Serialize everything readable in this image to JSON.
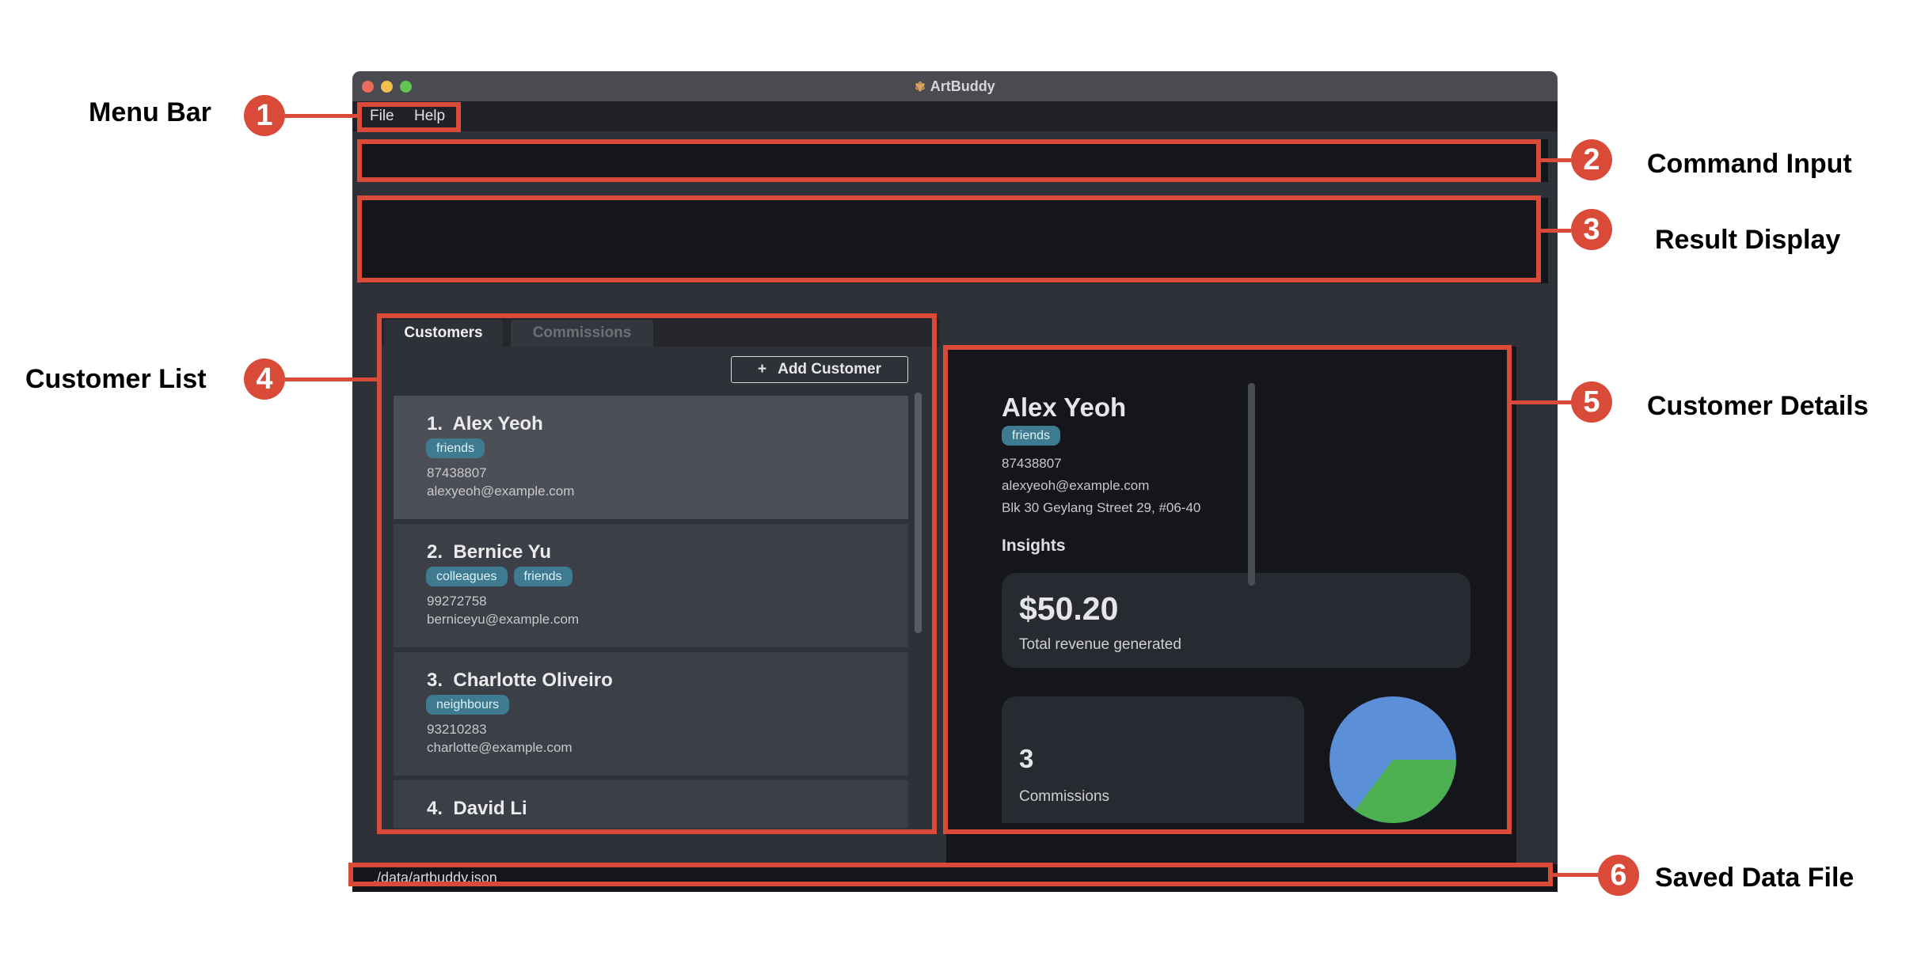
{
  "window": {
    "title": "ArtBuddy"
  },
  "menu": {
    "file": "File",
    "help": "Help"
  },
  "tabs": [
    {
      "label": "Customers"
    },
    {
      "label": "Commissions"
    }
  ],
  "add_customer": {
    "plus": "+",
    "label": "Add Customer"
  },
  "customers": [
    {
      "index": "1.",
      "name": "Alex Yeoh",
      "tags": [
        "friends"
      ],
      "phone": "87438807",
      "email": "alexyeoh@example.com"
    },
    {
      "index": "2.",
      "name": "Bernice Yu",
      "tags": [
        "colleagues",
        "friends"
      ],
      "phone": "99272758",
      "email": "berniceyu@example.com"
    },
    {
      "index": "3.",
      "name": "Charlotte Oliveiro",
      "tags": [
        "neighbours"
      ],
      "phone": "93210283",
      "email": "charlotte@example.com"
    },
    {
      "index": "4.",
      "name": "David Li",
      "tags": [],
      "phone": "",
      "email": ""
    }
  ],
  "details": {
    "name": "Alex Yeoh",
    "tag": "friends",
    "phone": "87438807",
    "email": "alexyeoh@example.com",
    "address": "Blk 30 Geylang Street 29, #06-40",
    "insights_heading": "Insights",
    "revenue_value": "$50.20",
    "revenue_label": "Total revenue generated",
    "commissions_value": "3",
    "commissions_label": "Commissions"
  },
  "status": {
    "file_path": "./data/artbuddy.json"
  },
  "annotations": [
    {
      "number": "1",
      "label": "Menu Bar"
    },
    {
      "number": "2",
      "label": "Command Input"
    },
    {
      "number": "3",
      "label": "Result Display"
    },
    {
      "number": "4",
      "label": "Customer List"
    },
    {
      "number": "5",
      "label": "Customer Details"
    },
    {
      "number": "6",
      "label": "Saved Data File"
    }
  ],
  "colors": {
    "annotation_red": "#d94a38",
    "tag_blue": "#3e7a90",
    "pie_blue": "#5b8fd8",
    "pie_green": "#4caf50"
  }
}
